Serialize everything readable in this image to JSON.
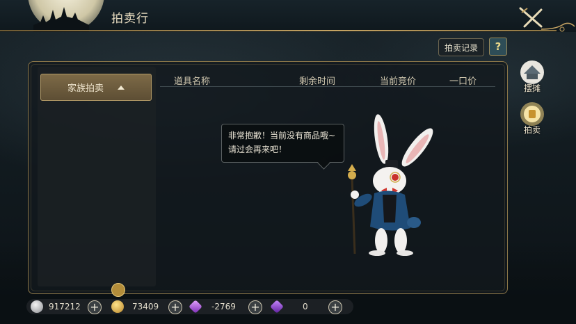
{
  "header": {
    "title": "拍卖行",
    "close_icon": "crossed-swords-icon"
  },
  "toolbar": {
    "record_label": "拍卖记录",
    "help_label": "?"
  },
  "left_tabs": [
    {
      "label": "家族拍卖",
      "selected": true,
      "icon": "triangle-up-icon"
    }
  ],
  "table": {
    "columns": [
      "道具名称",
      "剩余时间",
      "当前竞价",
      "一口价"
    ],
    "rows": []
  },
  "empty_message": "非常抱歉！当前没有商品哦~请过会再来吧！",
  "side_nav": [
    {
      "label": "摆摊",
      "icon": "stall-icon",
      "active": false
    },
    {
      "label": "拍卖",
      "icon": "auction-icon",
      "active": true
    }
  ],
  "currencies": [
    {
      "icon": "silver-coin-icon",
      "value": "917212"
    },
    {
      "icon": "gold-coin-icon",
      "value": "73409"
    },
    {
      "icon": "purple-gem-icon",
      "value": "-2769"
    },
    {
      "icon": "violet-gem-icon",
      "value": "0"
    }
  ],
  "colors": {
    "accent_gold": "#c6a463",
    "tab_bg": "#6e5d3f",
    "panel_bg": "#12191d"
  }
}
